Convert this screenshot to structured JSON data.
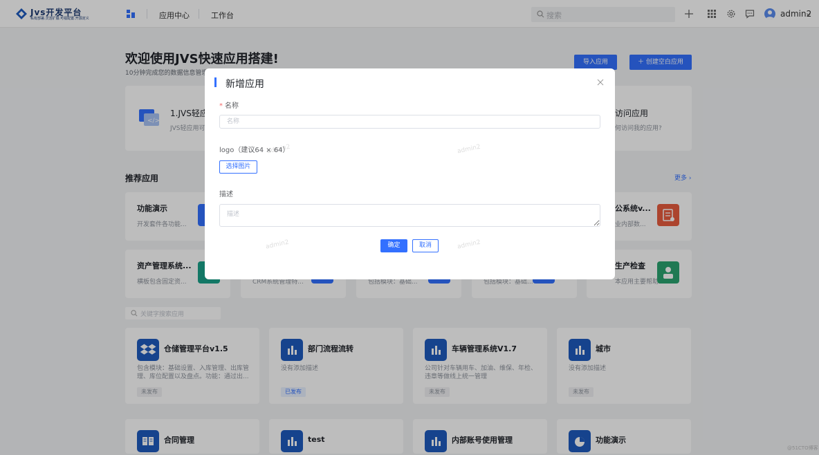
{
  "header": {
    "brand_title": "Jvs开发平台",
    "brand_subtitle": "私有部署.灵活扩展.可视配置.开源定义",
    "nav": [
      "应用中心",
      "工作台"
    ],
    "search_placeholder": "搜索",
    "user_name": "admin2"
  },
  "page": {
    "welcome_title": "欢迎使用JVS快速应用搭建!",
    "welcome_subtitle": "10分钟完成您的数据信息管理",
    "import_button": "导入应用",
    "create_button": "创建空白应用"
  },
  "guides": [
    {
      "title": "1.JVS轻应",
      "desc": "JVS轻应用可"
    },
    {
      "title": "访问应用",
      "desc": "何访问我的应用?"
    }
  ],
  "recommend": {
    "title": "推荐应用",
    "more": "更多",
    "cards": [
      {
        "name": "功能演示",
        "desc": "开发套件各功能..."
      },
      {
        "name": "公系统v...",
        "desc": "业内部数..."
      },
      {
        "name": "资产管理系统...",
        "desc": "横板包含固定资..."
      },
      {
        "name": "",
        "desc": "CRM系统管理特..."
      },
      {
        "name": "",
        "desc": "包括模块：基础..."
      },
      {
        "name": "",
        "desc": "包括模块：基础..."
      },
      {
        "name": "生产检查",
        "desc": "本应用主要帮助..."
      }
    ]
  },
  "apps": {
    "search_placeholder": "关键字搜索应用",
    "items": [
      {
        "name": "仓储管理平台v1.5",
        "desc": "包含模块：基础设置、入库管理、出库管理、库位配置以及盘点。功能：通过出...",
        "status": "未发布",
        "published": false
      },
      {
        "name": "部门流程流转",
        "desc": "没有添加描述",
        "status": "已发布",
        "published": true
      },
      {
        "name": "车辆管理系统V1.7",
        "desc": "公司针对车辆用车、加油、维保、年检、违章等做线上统一管理",
        "status": "未发布",
        "published": false
      },
      {
        "name": "城市",
        "desc": "没有添加描述",
        "status": "未发布",
        "published": false
      },
      {
        "name": "合同管理"
      },
      {
        "name": "test"
      },
      {
        "name": "内部账号使用管理"
      },
      {
        "name": "功能演示"
      }
    ]
  },
  "watermark": "admin2",
  "corner_mark": "@51CTO博客",
  "modal": {
    "title": "新增应用",
    "name_label": "名称",
    "name_placeholder": "名称",
    "logo_label": "logo（建议64 × 64）",
    "pick_button": "选择图片",
    "desc_label": "描述",
    "desc_placeholder": "描述",
    "ok_button": "确定",
    "cancel_button": "取消"
  },
  "colors": {
    "primary": "#3370ff",
    "app_icon": "#1e5bbf",
    "required": "#f56c6c"
  }
}
